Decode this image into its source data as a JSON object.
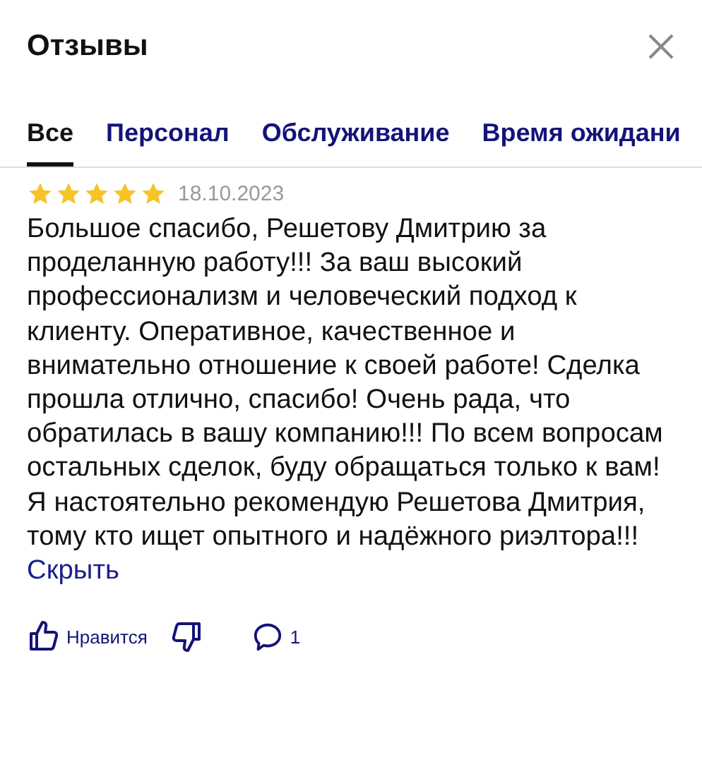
{
  "title": "Отзывы",
  "tabs": [
    {
      "label": "Все",
      "selected": true
    },
    {
      "label": "Персонал",
      "selected": false
    },
    {
      "label": "Обслуживание",
      "selected": false
    },
    {
      "label": "Время ожидани",
      "selected": false
    }
  ],
  "review": {
    "stars": 5,
    "date": "18.10.2023",
    "paragraphs": [
      "Большое спасибо, Решетову Дмитрию за проделанную работу!!! За ваш высокий профессионализм и человеческий подход к клиенту. Оперативное, качественное и внимательно отношение к своей работе! Сделка прошла отлично, спасибо! Очень рада, что обратилась в вашу компанию!!! По всем вопросам остальных сделок, буду обращаться только к вам!",
      "Я настоятельно рекомендую Решетова Дмитрия, тому кто ищет опытного и надёжного риэлтора!!!"
    ],
    "hide_link": "Скрыть",
    "like_label": "Нравится",
    "comment_count": "1"
  }
}
